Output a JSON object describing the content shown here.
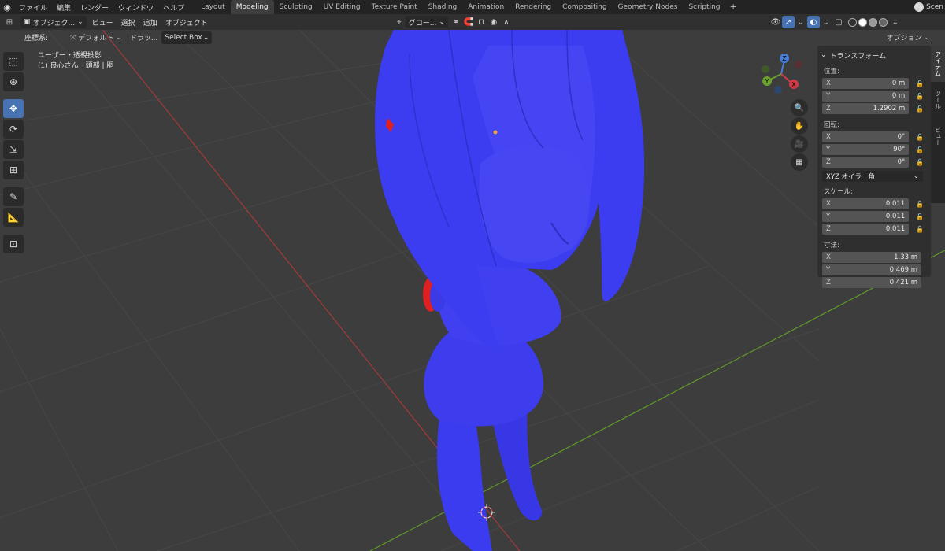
{
  "topbar": {
    "menus": [
      "ファイル",
      "編集",
      "レンダー",
      "ウィンドウ",
      "ヘルプ"
    ],
    "workspaces": [
      "Layout",
      "Modeling",
      "Sculpting",
      "UV Editing",
      "Texture Paint",
      "Shading",
      "Animation",
      "Rendering",
      "Compositing",
      "Geometry Nodes",
      "Scripting"
    ],
    "active_workspace": "Modeling",
    "add_tab": "+",
    "scene_label": "Scen"
  },
  "header": {
    "mode": "オブジェク...",
    "view": "ビュー",
    "select": "選択",
    "add": "追加",
    "object": "オブジェクト",
    "transform_orientation": "グロー...",
    "options": "オプション"
  },
  "header2": {
    "orientation_label": "座標系:",
    "orientation_value": "デフォルト",
    "drag_label": "ドラッ...",
    "drag_value": "Select Box"
  },
  "viewport": {
    "view_name": "ユーザー・透視投影",
    "object_info": "(1) 良心さん　頭部 | 胴"
  },
  "gizmo": {
    "x": "X",
    "y": "Y",
    "z": "Z"
  },
  "npanel": {
    "title": "トランスフォーム",
    "location_label": "位置:",
    "location": [
      {
        "axis": "X",
        "value": "0 m"
      },
      {
        "axis": "Y",
        "value": "0 m"
      },
      {
        "axis": "Z",
        "value": "1.2902 m"
      }
    ],
    "rotation_label": "回転:",
    "rotation": [
      {
        "axis": "X",
        "value": "0°"
      },
      {
        "axis": "Y",
        "value": "90°"
      },
      {
        "axis": "Z",
        "value": "0°"
      }
    ],
    "rotation_mode": "XYZ オイラー角",
    "scale_label": "スケール:",
    "scale": [
      {
        "axis": "X",
        "value": "0.011"
      },
      {
        "axis": "Y",
        "value": "0.011"
      },
      {
        "axis": "Z",
        "value": "0.011"
      }
    ],
    "dimensions_label": "寸法:",
    "dimensions": [
      {
        "axis": "X",
        "value": "1.33 m"
      },
      {
        "axis": "Y",
        "value": "0.469 m"
      },
      {
        "axis": "Z",
        "value": "0.421 m"
      }
    ]
  },
  "sidetabs": [
    "アイテム",
    "ツール",
    "ビュー"
  ],
  "colors": {
    "accent": "#4772b3",
    "model": "#3a3af0",
    "selection": "#e02020"
  }
}
